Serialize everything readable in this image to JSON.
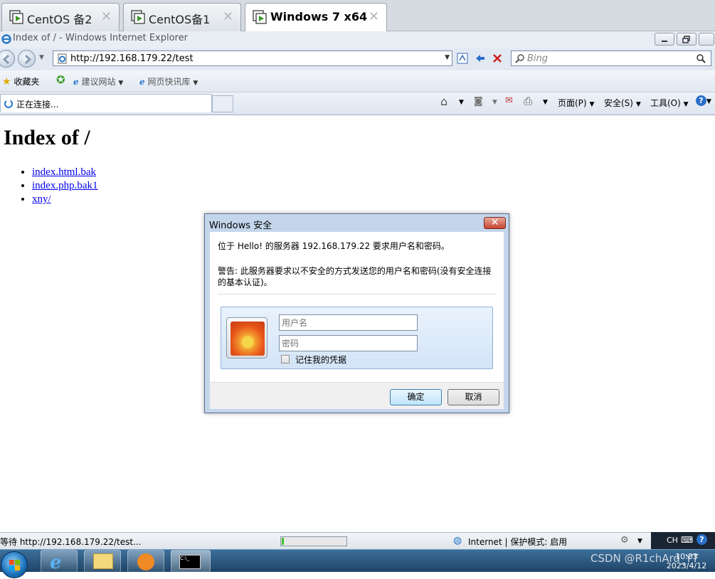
{
  "vm_tabs": [
    {
      "label": "CentOS 备2",
      "active": false
    },
    {
      "label": "CentOS备1",
      "active": false
    },
    {
      "label": "Windows 7 x64",
      "active": true
    }
  ],
  "browser": {
    "window_title": "Index of / - Windows Internet Explorer",
    "address": "http://192.168.179.22/test",
    "search_placeholder": "Bing",
    "favorites": {
      "label": "收藏夹",
      "items": [
        "建议网站",
        "网页快讯库"
      ]
    },
    "tab_label": "正在连接...",
    "commands": {
      "page": "页面(P)",
      "safety": "安全(S)",
      "tools": "工具(O)"
    }
  },
  "page": {
    "heading": "Index of /",
    "links": [
      "index.html.bak",
      "index.php.bak1",
      "xny/"
    ]
  },
  "dialog": {
    "title": "Windows 安全",
    "message": "位于 Hello! 的服务器 192.168.179.22 要求用户名和密码。",
    "warning_line1": "警告: 此服务器要求以不安全的方式发送您的用户名和密码(没有安全连接",
    "warning_line2": "的基本认证)。",
    "username_placeholder": "用户名",
    "password_placeholder": "密码",
    "remember_label": "记住我的凭据",
    "ok": "确定",
    "cancel": "取消"
  },
  "status_bar": {
    "text": "等待 http://192.168.179.22/test...",
    "progress": 0.03,
    "zone": "Internet | 保护模式: 启用",
    "lang": "CH"
  },
  "taskbar": {
    "time": "10:03",
    "date": "2023/4/12",
    "watermark": "CSDN @R1chArd_YT"
  },
  "colors": {
    "accent": "#1f4467",
    "link": "#0000ee",
    "dialog_frame": "#c4d6ec"
  }
}
